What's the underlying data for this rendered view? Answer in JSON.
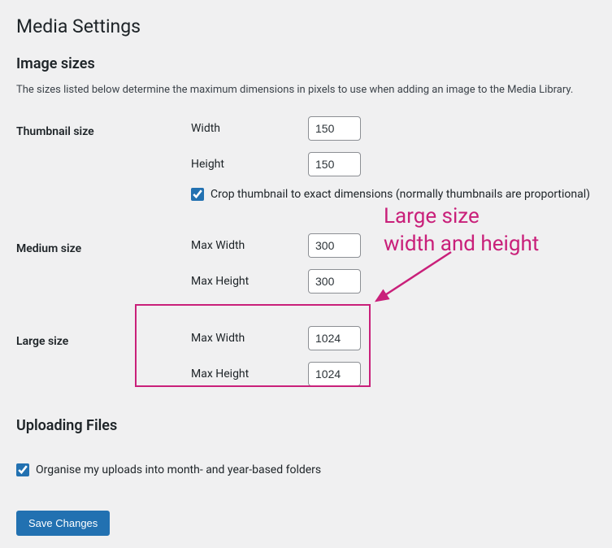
{
  "page": {
    "title": "Media Settings"
  },
  "image_sizes": {
    "heading": "Image sizes",
    "description": "The sizes listed below determine the maximum dimensions in pixels to use when adding an image to the Media Library."
  },
  "thumbnail": {
    "label": "Thumbnail size",
    "width_label": "Width",
    "width_value": "150",
    "height_label": "Height",
    "height_value": "150",
    "crop_label": "Crop thumbnail to exact dimensions (normally thumbnails are proportional)",
    "crop_checked": true
  },
  "medium": {
    "label": "Medium size",
    "max_width_label": "Max Width",
    "max_width_value": "300",
    "max_height_label": "Max Height",
    "max_height_value": "300"
  },
  "large": {
    "label": "Large size",
    "max_width_label": "Max Width",
    "max_width_value": "1024",
    "max_height_label": "Max Height",
    "max_height_value": "1024"
  },
  "uploading": {
    "heading": "Uploading Files",
    "organise_label": "Organise my uploads into month- and year-based folders",
    "organise_checked": true
  },
  "actions": {
    "save_label": "Save Changes"
  },
  "annotation": {
    "text": "Large size\nwidth and height",
    "color": "#c9207a"
  }
}
